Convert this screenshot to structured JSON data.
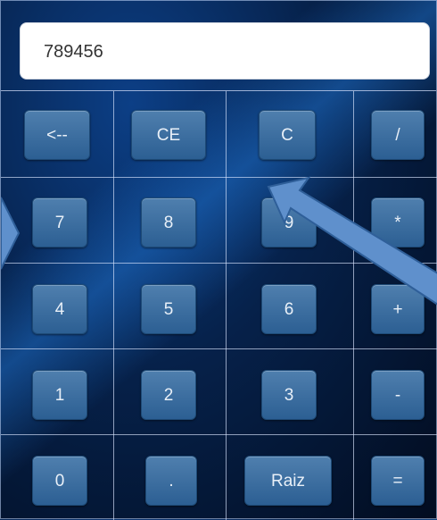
{
  "display": {
    "value": "789456"
  },
  "buttons": {
    "backspace": "<--",
    "ce": "CE",
    "c": "C",
    "divide": "/",
    "seven": "7",
    "eight": "8",
    "nine": "9",
    "multiply": "*",
    "four": "4",
    "five": "5",
    "six": "6",
    "plus": "+",
    "one": "1",
    "two": "2",
    "three": "3",
    "minus": "-",
    "zero": "0",
    "dot": ".",
    "raiz": "Raiz",
    "equals": "="
  },
  "colors": {
    "button": "#3b6d9e",
    "arrow": "#5f90cc"
  }
}
